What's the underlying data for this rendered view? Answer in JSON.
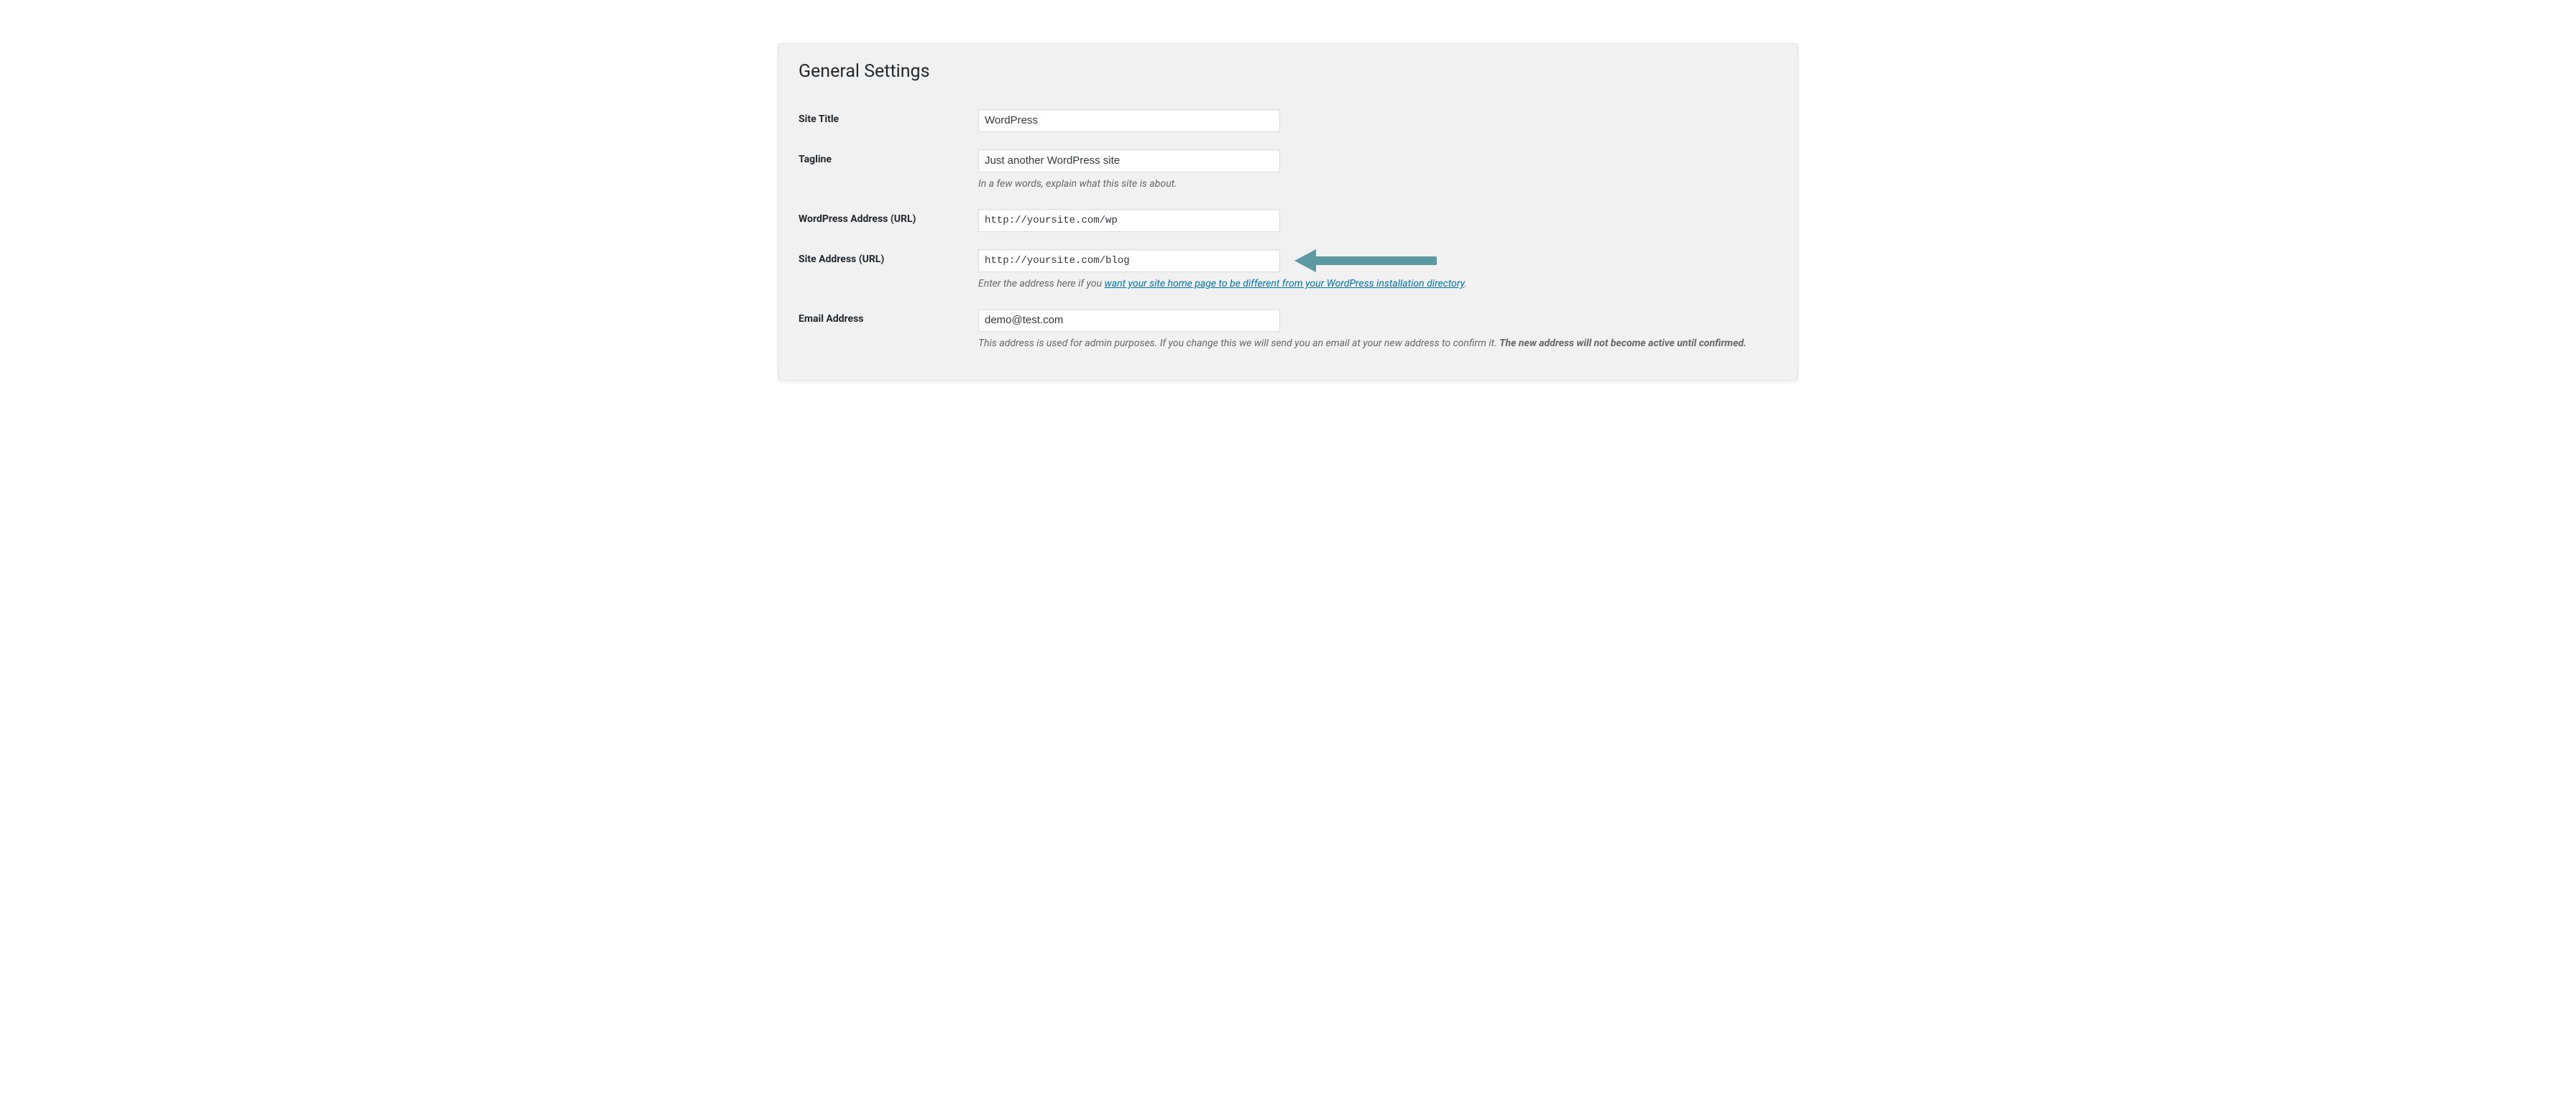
{
  "page_title": "General Settings",
  "fields": {
    "site_title": {
      "label": "Site Title",
      "value": "WordPress"
    },
    "tagline": {
      "label": "Tagline",
      "value": "Just another WordPress site",
      "description": "In a few words, explain what this site is about."
    },
    "wp_address": {
      "label": "WordPress Address (URL)",
      "value": "http://yoursite.com/wp"
    },
    "site_address": {
      "label": "Site Address (URL)",
      "value": "http://yoursite.com/blog",
      "desc_prefix": "Enter the address here if you ",
      "desc_link": "want your site home page to be different from your WordPress installation directory",
      "desc_suffix": "."
    },
    "email": {
      "label": "Email Address",
      "value": "demo@test.com",
      "desc_plain": "This address is used for admin purposes. If you change this we will send you an email at your new address to confirm it. ",
      "desc_bold": "The new address will not become active until confirmed."
    }
  },
  "annotation": {
    "arrow_color": "#5b9aa0"
  }
}
